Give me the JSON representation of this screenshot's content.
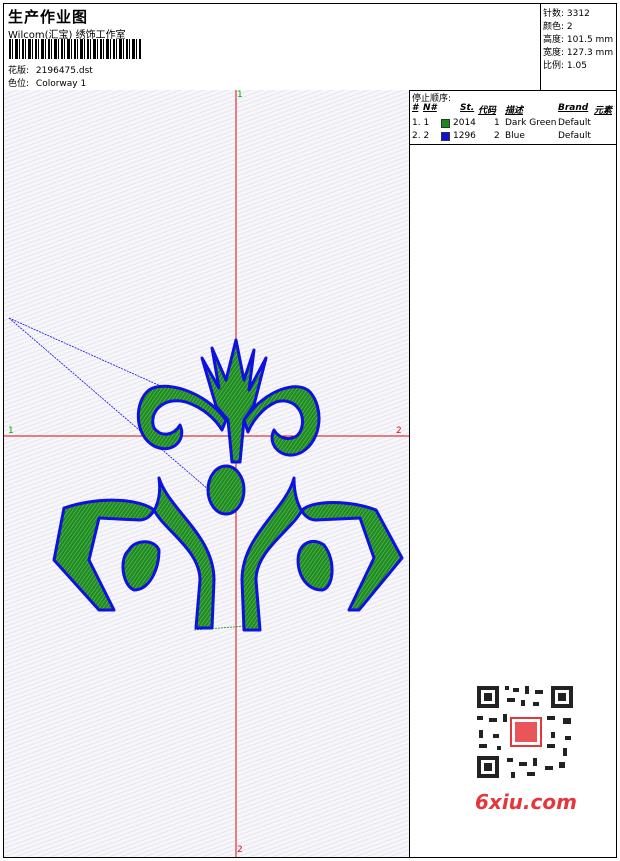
{
  "header": {
    "title": "生产作业图",
    "subtitle": "Wilcom(汇宝) 绣饰工作室",
    "design_label": "花版:",
    "design_value": "2196475.dst",
    "colorway_label": "色位:",
    "colorway_value": "Colorway 1"
  },
  "info": {
    "stitches_label": "针数:",
    "stitches_value": "3312",
    "colors_label": "颜色:",
    "colors_value": "2",
    "height_label": "高度:",
    "height_value": "101.5 mm",
    "width_label": "宽度:",
    "width_value": "127.3 mm",
    "scale_label": "比例:",
    "scale_value": "1.05"
  },
  "stops": {
    "title": "停止顺序:",
    "columns": [
      "#",
      "N#",
      "St.",
      "代码",
      "描述",
      "Brand",
      "元素"
    ],
    "rows": [
      {
        "index": "1. 1",
        "color": "#1a8a1a",
        "stitches": "2014",
        "code": "1",
        "desc": "Dark Green",
        "brand": "Default"
      },
      {
        "index": "2. 2",
        "color": "#1010d8",
        "stitches": "1296",
        "code": "2",
        "desc": "Blue",
        "brand": "Default"
      }
    ]
  },
  "axes": {
    "top": "1",
    "left": "1",
    "right": "2",
    "bottom": "2"
  },
  "watermark": "6xiu.com",
  "colors": {
    "fill_green": "#1e8c1e",
    "outline_blue": "#1010e0",
    "crosshair": "#d01010"
  }
}
